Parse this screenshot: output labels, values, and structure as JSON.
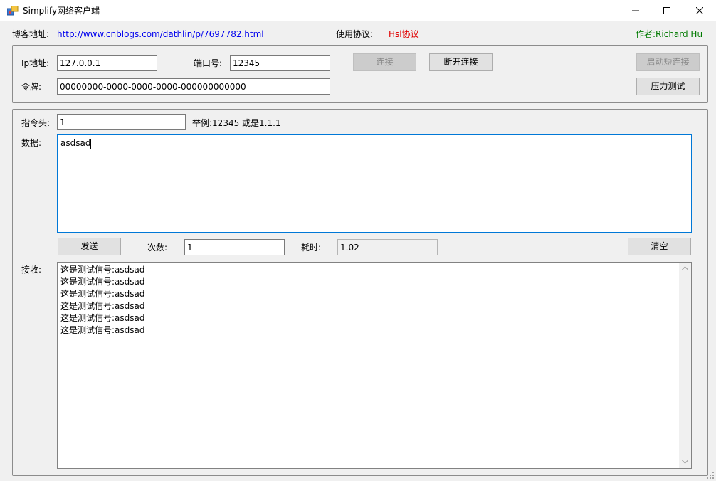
{
  "window": {
    "title": "Simplify网络客户端"
  },
  "header": {
    "blog_label": "博客地址:",
    "blog_url": "http://www.cnblogs.com/dathlin/p/7697782.html",
    "protocol_label": "使用协议:",
    "protocol_value": "Hsl协议",
    "author": "作者:Richard Hu"
  },
  "connection": {
    "ip_label": "Ip地址:",
    "ip_value": "127.0.0.1",
    "port_label": "端口号:",
    "port_value": "12345",
    "token_label": "令牌:",
    "token_value": "00000000-0000-0000-0000-000000000000",
    "connect_button": "连接",
    "disconnect_button": "断开连接",
    "start_short_button": "启动短连接",
    "stress_test_button": "压力测试"
  },
  "message": {
    "head_label": "指令头:",
    "head_value": "1",
    "example_text": "举例:12345 或是1.1.1",
    "data_label": "数据:",
    "data_value": "asdsad",
    "send_button": "发送",
    "count_label": "次数:",
    "count_value": "1",
    "elapsed_label": "耗时:",
    "elapsed_value": "1.02",
    "clear_button": "清空",
    "receive_label": "接收:",
    "received_lines": [
      "这是测试信号:asdsad",
      "这是测试信号:asdsad",
      "这是测试信号:asdsad",
      "这是测试信号:asdsad",
      "这是测试信号:asdsad",
      "这是测试信号:asdsad"
    ]
  },
  "colors": {
    "link": "#0000ee",
    "protocol": "#e00000",
    "author": "#007a00",
    "focus_border": "#0078d7"
  }
}
